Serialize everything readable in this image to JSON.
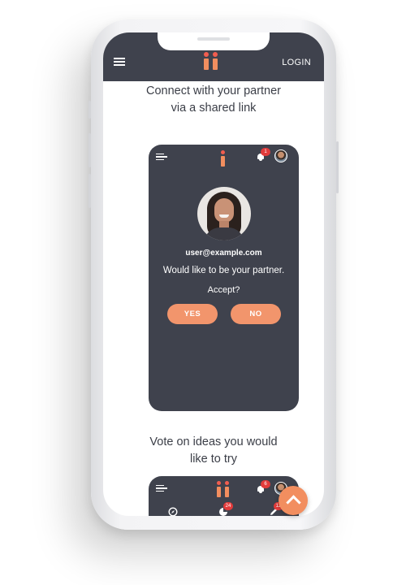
{
  "header": {
    "login_label": "LOGIN",
    "logo_text": "ii",
    "menu_icon": "hamburger-icon"
  },
  "sections": [
    {
      "caption_line1": "Connect with your partner",
      "caption_line2": "via a shared link"
    },
    {
      "caption_line1": "Vote on ideas you would",
      "caption_line2": "like to try"
    }
  ],
  "partner_card": {
    "logo_text": "i",
    "notification_count": "1",
    "email": "user@example.com",
    "message": "Would like to be your partner.",
    "question": "Accept?",
    "yes_label": "YES",
    "no_label": "NO"
  },
  "vote_card": {
    "logo_text": "ii",
    "notification_count": "6",
    "tabs": [
      {
        "icon": "compass-icon",
        "badge": ""
      },
      {
        "icon": "pie-chart-icon",
        "badge": "24"
      },
      {
        "icon": "pencil-icon",
        "badge": "12"
      }
    ]
  },
  "colors": {
    "dark": "#3f424d",
    "accent": "#f28e5f",
    "logo_dot": "#f25d4f",
    "badge": "#e23b3b"
  },
  "fab": {
    "icon": "chevron-up-icon"
  }
}
